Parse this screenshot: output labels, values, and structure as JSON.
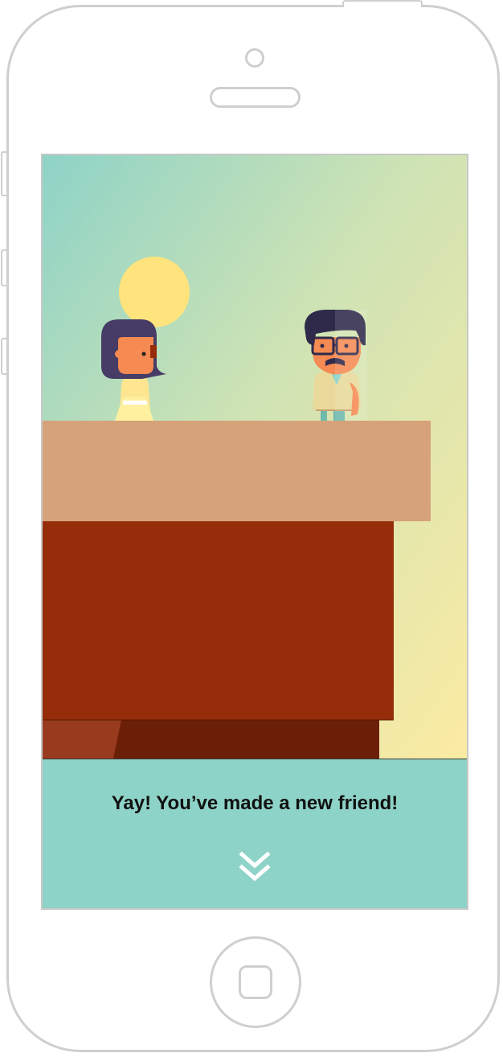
{
  "dialog": {
    "message": "Yay! You’ve made a new friend!",
    "advance_icon": "double-chevron-down-icon"
  },
  "colors": {
    "sky_top": "#8ed3c7",
    "sky_bottom": "#f8ebaa",
    "sun": "#ffe37d",
    "ledge": "#d6a27a",
    "cliff": "#952d0a",
    "cliff_shadow": "#6a1f06",
    "dialog_bg": "#8ed3c7",
    "hair": "#463c66",
    "skin": "#f58a52"
  }
}
